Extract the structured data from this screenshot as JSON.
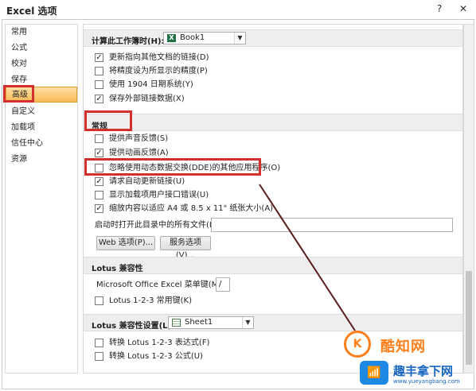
{
  "window": {
    "title": "Excel 选项",
    "help_glyph": "?",
    "close_glyph": "✕"
  },
  "sidebar": {
    "items": [
      {
        "label": "常用"
      },
      {
        "label": "公式"
      },
      {
        "label": "校对"
      },
      {
        "label": "保存"
      },
      {
        "label": "高级",
        "selected": true
      },
      {
        "label": "自定义"
      },
      {
        "label": "加载项"
      },
      {
        "label": "信任中心"
      },
      {
        "label": "资源"
      }
    ]
  },
  "workbook_section": {
    "label": "计算此工作簿时(H):",
    "workbook_value": "Book1",
    "options": [
      {
        "label": "更新指向其他文档的链接(D)",
        "checked": true
      },
      {
        "label": "将精度设为所显示的精度(P)",
        "checked": false
      },
      {
        "label": "使用 1904 日期系统(Y)",
        "checked": false
      },
      {
        "label": "保存外部链接数据(X)",
        "checked": true
      }
    ]
  },
  "general_section": {
    "title": "常规",
    "options": [
      {
        "label": "提供声音反馈(S)",
        "checked": false
      },
      {
        "label": "提供动画反馈(A)",
        "checked": true
      },
      {
        "label": "忽略使用动态数据交换(DDE)的其他应用程序(O)",
        "checked": false
      },
      {
        "label": "请求自动更新链接(U)",
        "checked": true
      },
      {
        "label": "显示加载项用户接口错误(U)",
        "checked": false
      },
      {
        "label": "缩放内容以适应 A4 或 8.5 x 11\" 纸张大小(A)",
        "checked": true
      }
    ],
    "startup_label": "启动时打开此目录中的所有文件(L):",
    "startup_value": "",
    "web_options_button": "Web 选项(P)...",
    "service_options_button": "服务选项(V)..."
  },
  "lotus_section": {
    "title": "Lotus 兼容性",
    "menu_key_label": "Microsoft Office Excel 菜单键(M):",
    "menu_key_value": "/",
    "nav_keys_label": "Lotus 1-2-3 常用键(K)",
    "nav_keys_checked": false
  },
  "lotus_settings_section": {
    "title": "Lotus 兼容性设置(L):",
    "sheet_value": "Sheet1",
    "options": [
      {
        "label": "转换 Lotus 1-2-3 表达式(F)",
        "checked": false
      },
      {
        "label": "转换 Lotus 1-2-3 公式(U)",
        "checked": false
      }
    ]
  },
  "watermark": {
    "logo_glyph": "K",
    "text": "酷知网",
    "brand": "趣丰拿下网",
    "url": "www.yueyangbang.com"
  },
  "colors": {
    "highlight": "#d32f2f",
    "selected_item": "#f8b955",
    "watermark_orange": "#ff7f1a",
    "watermark_blue": "#1565c0"
  }
}
